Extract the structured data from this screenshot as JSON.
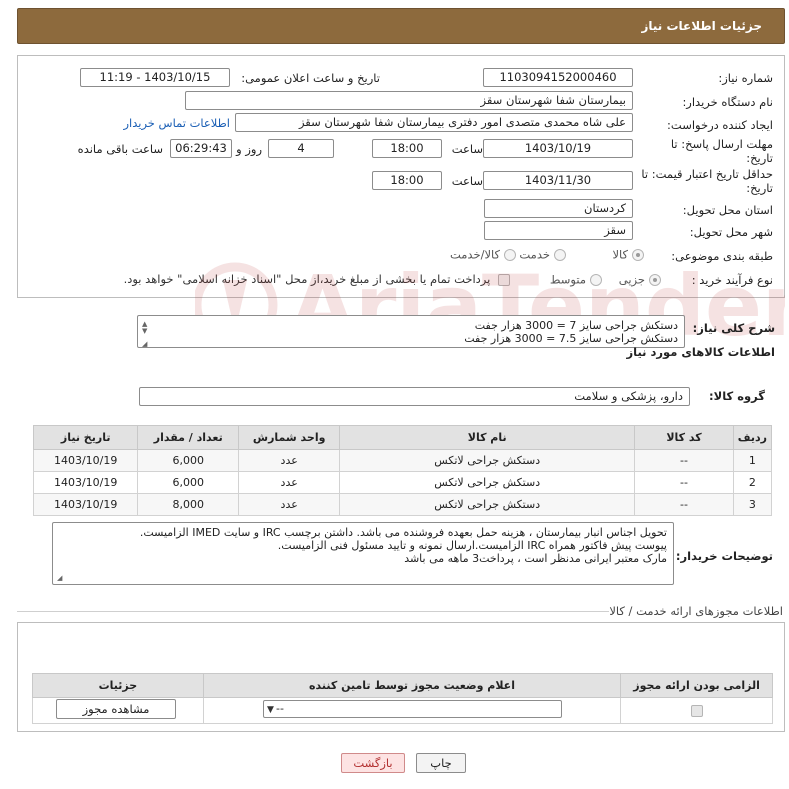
{
  "header": {
    "title": "جزئیات اطلاعات نیاز"
  },
  "form": {
    "need_number_label": "شماره نیاز:",
    "need_number": "1103094152000460",
    "announce_label": "تاریخ و ساعت اعلان عمومی:",
    "announce_value": "1403/10/15 - 11:19",
    "buyer_org_label": "نام دستگاه خریدار:",
    "buyer_org": "بیمارستان شفا شهرستان سقز",
    "requester_label": "ایجاد کننده درخواست:",
    "requester": "علی شاه محمدی متصدی امور دفتری بیمارستان شفا شهرستان سقز",
    "contact_link": "اطلاعات تماس خریدار",
    "deadline_label_1": "مهلت ارسال پاسخ: تا",
    "deadline_label_2": "تاریخ:",
    "deadline_date": "1403/10/19",
    "time_label": "ساعت",
    "deadline_time": "18:00",
    "days_value": "4",
    "days_label": "روز و",
    "remaining_time": "06:29:43",
    "remaining_label": "ساعت باقی مانده",
    "validity_label_1": "حداقل تاریخ اعتبار قیمت: تا",
    "validity_label_2": "تاریخ:",
    "validity_date": "1403/11/30",
    "validity_time": "18:00",
    "province_label": "استان محل تحویل:",
    "province": "کردستان",
    "city_label": "شهر محل تحویل:",
    "city": "سقز",
    "category_label": "طبقه بندی موضوعی:",
    "category_options": [
      "کالا",
      "خدمت",
      "کالا/خدمت"
    ],
    "category_selected": "کالا",
    "purchase_label": "نوع فرآیند خرید :",
    "purchase_options": [
      "جزیی",
      "متوسط"
    ],
    "purchase_selected": "جزیی",
    "payment_note": "پرداخت تمام یا بخشی از مبلغ خرید،از محل \"اسناد خزانه اسلامی\" خواهد بود."
  },
  "summary": {
    "label": "شرح کلی نیاز:",
    "line1": "دستکش جراحی سایز 7 = 3000 هزار جفت",
    "line2": "دستکش جراحی سایز 7.5 = 3000 هزار جفت"
  },
  "goods": {
    "section_title": "اطلاعات کالاهای مورد نیاز",
    "group_label": "گروه کالا:",
    "group_value": "دارو، پزشکی و سلامت",
    "columns": [
      "ردیف",
      "کد کالا",
      "نام کالا",
      "واحد شمارش",
      "تعداد / مقدار",
      "تاریخ نیاز"
    ],
    "rows": [
      {
        "idx": "1",
        "code": "--",
        "name": "دستکش جراحی لاتکس",
        "unit": "عدد",
        "qty": "6,000",
        "date": "1403/10/19"
      },
      {
        "idx": "2",
        "code": "--",
        "name": "دستکش جراحی لاتکس",
        "unit": "عدد",
        "qty": "6,000",
        "date": "1403/10/19"
      },
      {
        "idx": "3",
        "code": "--",
        "name": "دستکش جراحی لاتکس",
        "unit": "عدد",
        "qty": "8,000",
        "date": "1403/10/19"
      }
    ]
  },
  "buyer_notes": {
    "label": "توضیحات خریدار:",
    "line1": "تحویل اجناس  انبار بیمارستان ، هزینه حمل بعهده فروشنده می باشد.  داشتن برچسب IRC  و سایت  IMED  الزامیست.",
    "line2": "پیوست پیش فاکتور همراه IRC  الزامیست.ارسال نمونه و تایید مسئول فنی الزامیست.",
    "line3": "مارک معتبر ایرانی مدنظر است ، پرداخت3 ماهه می باشد"
  },
  "permits": {
    "section_title": "اطلاعات مجوزهای ارائه خدمت / کالا",
    "columns": [
      "الزامی بودن ارائه مجوز",
      "اعلام وضعیت مجوز توسط تامین کننده",
      "جزئیات"
    ],
    "select_value": "--",
    "view_button": "مشاهده مجوز"
  },
  "actions": {
    "print": "چاپ",
    "back": "بازگشت"
  },
  "watermark": {
    "text": "AriaTender.net"
  }
}
